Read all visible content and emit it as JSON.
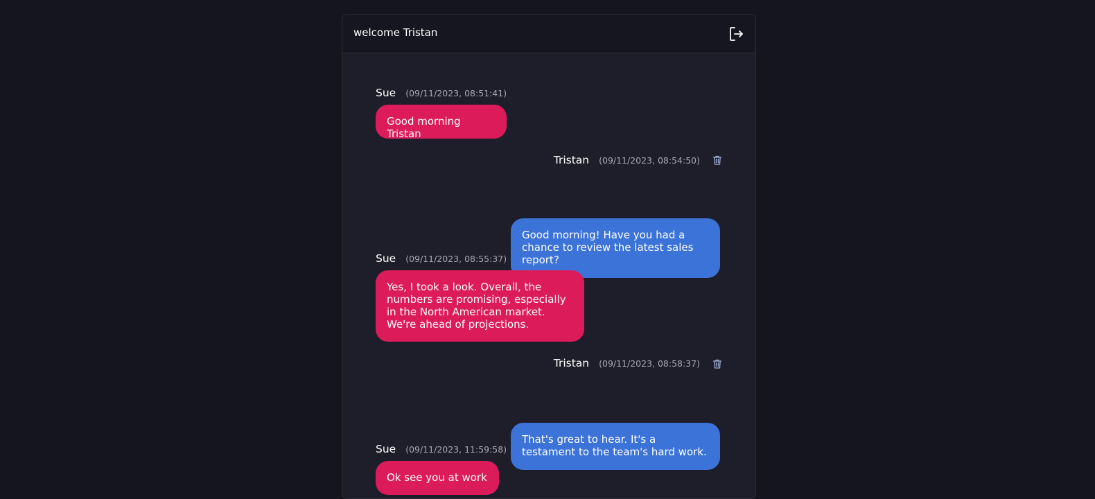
{
  "header": {
    "title": "welcome Tristan"
  },
  "messages": [
    {
      "sender": "Sue",
      "timestamp": "(09/11/2023, 08:51:41)",
      "text": "Good morning Tristan"
    },
    {
      "sender": "Tristan",
      "timestamp": "(09/11/2023, 08:54:50)",
      "text": "Good morning! Have you had a chance to review the latest sales report?"
    },
    {
      "sender": "Sue",
      "timestamp": "(09/11/2023, 08:55:37)",
      "text": "Yes, I took a look. Overall, the numbers are promising, especially in the North American market. We're ahead of projections."
    },
    {
      "sender": "Tristan",
      "timestamp": "(09/11/2023, 08:58:37)",
      "text": "That's great to hear. It's a testament to the team's hard work."
    },
    {
      "sender": "Sue",
      "timestamp": "(09/11/2023, 11:59:58)",
      "text": "Ok see you at work"
    }
  ],
  "colors": {
    "incoming": "#dc1c5a",
    "outgoing": "#3b73d8",
    "background": "#14151d",
    "panel": "#1d1e29"
  },
  "icons": {
    "logout": "logout-icon",
    "delete": "trash-icon"
  }
}
